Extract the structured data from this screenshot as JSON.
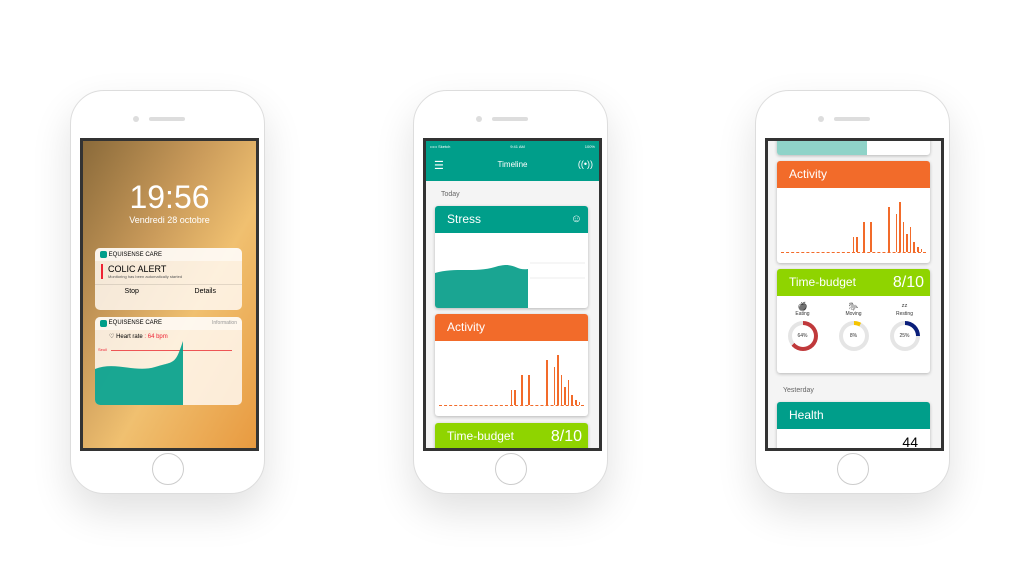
{
  "colors": {
    "teal": "#009e8a",
    "orange": "#f26b2a",
    "green": "#8fd400",
    "red": "#c0393b",
    "yellow": "#f5c400",
    "navy": "#0a1e7a"
  },
  "lock": {
    "time": "19:56",
    "date": "Vendredi 28 octobre",
    "alert": {
      "app": "EQUISENSE CARE",
      "title": "COLIC ALERT",
      "message": "Monitoring has been automatically started",
      "stop": "Stop",
      "details": "Details"
    },
    "info": {
      "app": "EQUISENSE CARE",
      "tag": "Information",
      "label": "Heart rate",
      "value": ": 64 bpm",
      "threshold": "Seuil"
    }
  },
  "timeline": {
    "status": {
      "carrier": "••••• Sketch",
      "time": "9:41 AM",
      "battery": "100%"
    },
    "title": "Timeline",
    "today": "Today",
    "stress": "Stress",
    "activity": "Activity",
    "time_budget": "Time-budget",
    "score": "8/10",
    "activity_bars": [
      0,
      0,
      0,
      0,
      0,
      0,
      0,
      0,
      0,
      0,
      0,
      0,
      0,
      0,
      0,
      0,
      0,
      0,
      0,
      0,
      15,
      15,
      0,
      30,
      0,
      30,
      0,
      0,
      0,
      0,
      45,
      0,
      38,
      50,
      30,
      18,
      25,
      10,
      5,
      3,
      0
    ]
  },
  "detail": {
    "activity": "Activity",
    "time_budget": "Time-budget",
    "score": "8/10",
    "budget": [
      {
        "label": "Eating",
        "pct": "64%",
        "value": 64,
        "color": "#c0393b",
        "icon": "apple-icon",
        "glyph": "🍎"
      },
      {
        "label": "Moving",
        "pct": "8%",
        "value": 8,
        "color": "#f5c400",
        "icon": "horse-icon",
        "glyph": "🐎"
      },
      {
        "label": "Resting",
        "pct": "25%",
        "value": 25,
        "color": "#0a1e7a",
        "icon": "sleep-icon",
        "glyph": "ᶻᶻ"
      }
    ],
    "yesterday": "Yesterday",
    "health": "Health",
    "health_value": "44"
  }
}
